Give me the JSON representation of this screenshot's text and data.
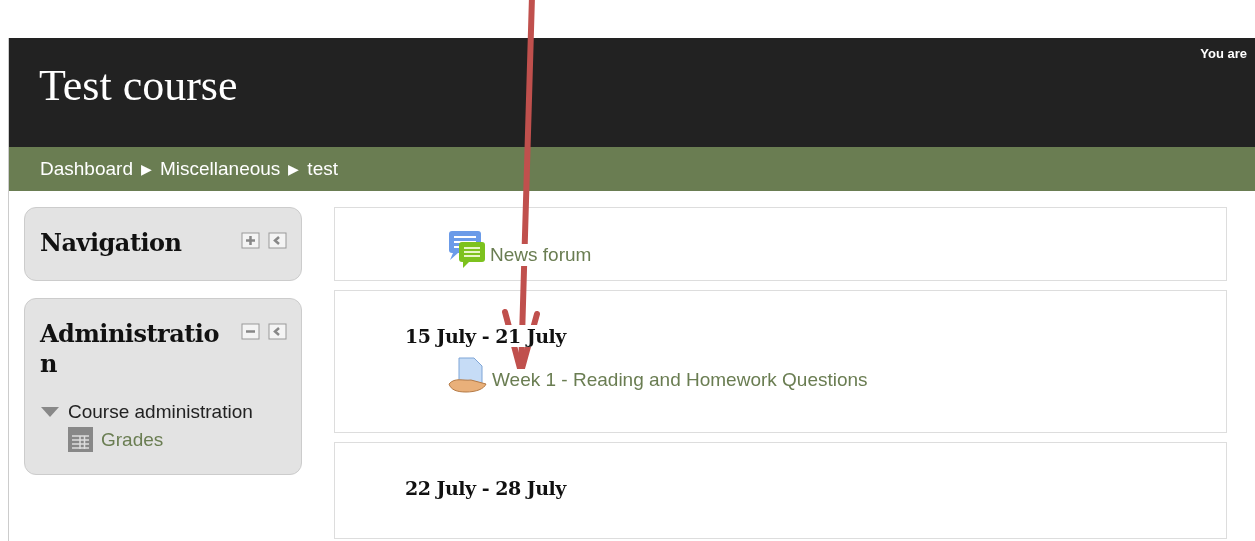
{
  "header": {
    "title": "Test course",
    "login_info": "You are"
  },
  "breadcrumb": [
    {
      "kind": "link",
      "text": "Dashboard"
    },
    {
      "kind": "separator",
      "text": "▶"
    },
    {
      "kind": "link",
      "text": "Miscellaneous"
    },
    {
      "kind": "separator",
      "text": "▶"
    },
    {
      "kind": "link",
      "text": "test"
    }
  ],
  "blocks": [
    {
      "title": "Navigation",
      "expanded": false
    },
    {
      "title": "Administratio n",
      "expanded": true,
      "items": [
        {
          "label": "Course administration",
          "kind": "folder"
        },
        {
          "label": "Grades",
          "kind": "grades"
        }
      ]
    }
  ],
  "sections": [
    {
      "activities": [
        {
          "label": "News forum",
          "kind": "forum"
        }
      ]
    },
    {
      "title": "15 July - 21 July",
      "activities": [
        {
          "label": "Week 1 - Reading and Homework Questions",
          "kind": "assignment"
        }
      ]
    },
    {
      "title": "22 July - 28 July"
    }
  ]
}
